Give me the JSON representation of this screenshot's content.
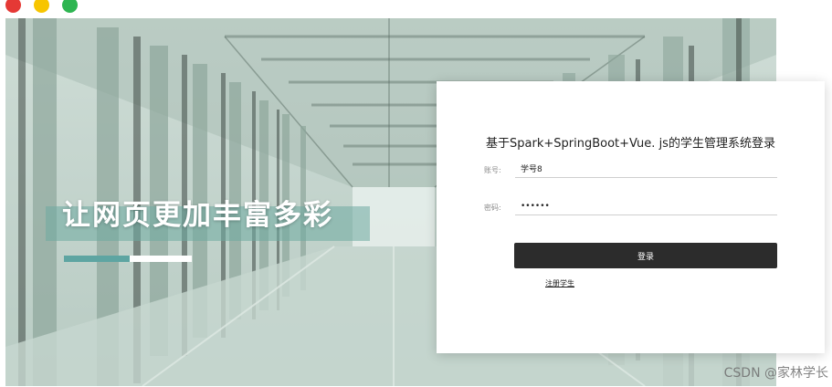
{
  "window": {
    "controls": [
      "close-dot",
      "minimize-dot",
      "maximize-dot"
    ]
  },
  "hero": {
    "slogan": "让网页更加丰富多彩"
  },
  "login": {
    "title": "基于Spark+SpringBoot+Vue. js的学生管理系统登录",
    "account_label": "账号:",
    "account_value": "学号8",
    "password_label": "密码:",
    "password_value": "••••••",
    "submit_label": "登录",
    "register_label": "注册学生"
  },
  "watermark": "CSDN @家林学长",
  "colors": {
    "accent_teal": "#5ea5a2",
    "button_dark": "#2c2c2c"
  }
}
